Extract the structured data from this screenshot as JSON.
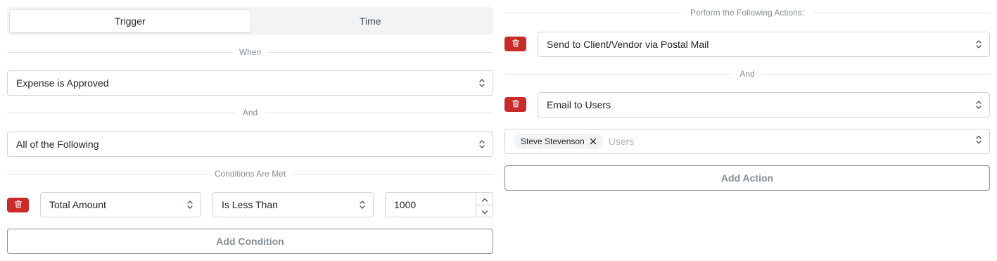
{
  "tabs": {
    "trigger": "Trigger",
    "time": "Time"
  },
  "left": {
    "when_label": "When",
    "trigger_select": "Expense is Approved",
    "and_label": "And",
    "match_select": "All of the Following",
    "conditions_label": "Conditions Are Met",
    "condition": {
      "field": "Total Amount",
      "operator": "Is Less Than",
      "value": "1000"
    },
    "add_condition": "Add Condition"
  },
  "right": {
    "actions_label": "Perform the Following Actions:",
    "action1": "Send to Client/Vendor via Postal Mail",
    "and_label": "And",
    "action2": "Email to Users",
    "users_pill": "Steve Stevenson",
    "users_placeholder": "Users",
    "add_action": "Add Action"
  },
  "colors": {
    "danger": "#c92a2a",
    "border": "#ced4da",
    "muted": "#868e96"
  },
  "icons": [
    "trash-icon",
    "chevron-updown-icon",
    "chevron-up-icon",
    "chevron-down-icon",
    "close-icon"
  ]
}
